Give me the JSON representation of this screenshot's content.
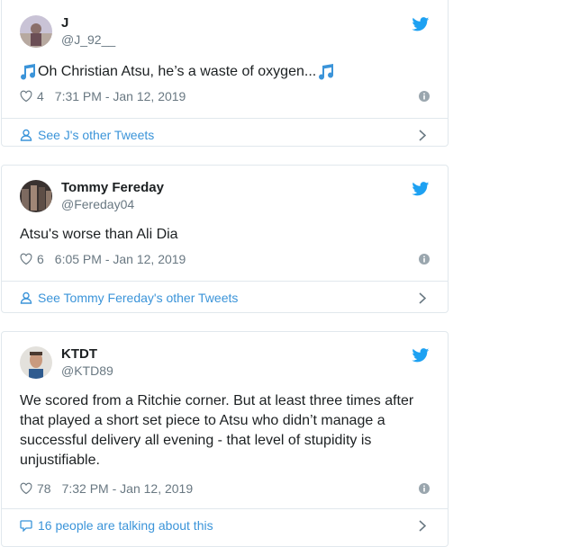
{
  "tweets": [
    {
      "display_name": "J",
      "handle": "@J_92__",
      "text_before": "Oh Christian Atsu, he’s a waste of oxygen... ",
      "likes": "4",
      "timestamp": "7:31 PM - Jan 12, 2019",
      "footer": "See J's other Tweets",
      "footer_icon": "person-icon"
    },
    {
      "display_name": "Tommy Fereday",
      "handle": "@Fereday04",
      "text": "Atsu's worse than Ali Dia",
      "likes": "6",
      "timestamp": "6:05 PM - Jan 12, 2019",
      "footer": "See Tommy Fereday's other Tweets",
      "footer_icon": "person-icon"
    },
    {
      "display_name": "KTDT",
      "handle": "@KTD89",
      "text": "We scored from a Ritchie corner. But at least three times after that played a short set piece to Atsu who didn’t manage a successful delivery all evening - that level of stupidity is unjustifiable.",
      "likes": "78",
      "timestamp": "7:32 PM - Jan 12, 2019",
      "footer": "16 people are talking about this",
      "footer_icon": "speech-bubble-icon"
    }
  ],
  "colors": {
    "twitter_blue": "#1da1f2",
    "link_blue": "#3b94d9",
    "muted": "#697882",
    "border": "#e1e8ed"
  }
}
